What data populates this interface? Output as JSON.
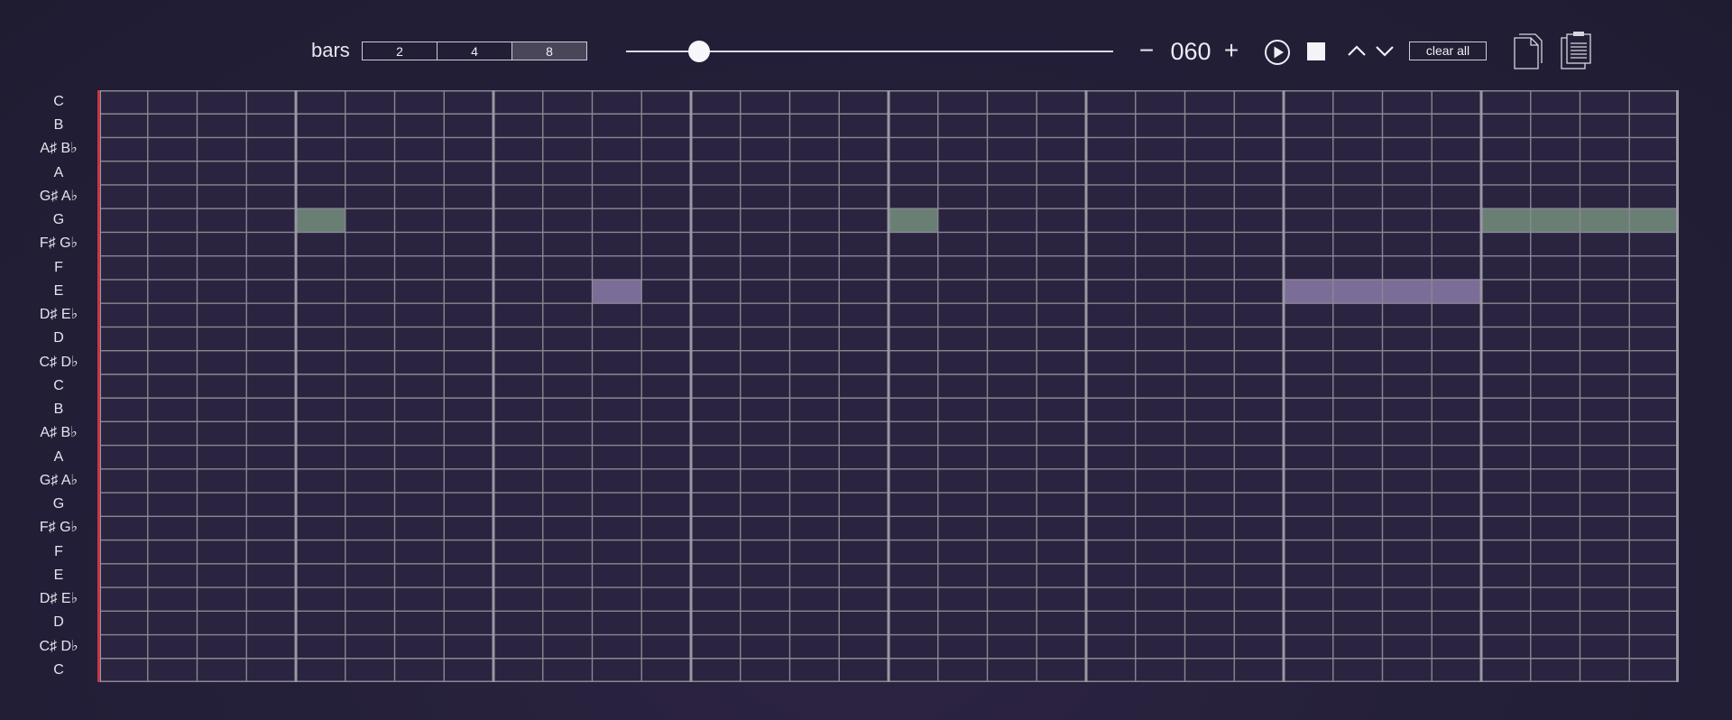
{
  "toolbar": {
    "bars_label": "bars",
    "bar_options": [
      "2",
      "4",
      "8"
    ],
    "bars_selected": "8",
    "tempo_position": 0.15,
    "tempo_minus": "−",
    "tempo_value": "060",
    "tempo_plus": "+",
    "play_icon": "play-icon",
    "stop_icon": "stop-icon",
    "octave_up_icon": "chevron-up-icon",
    "octave_down_icon": "chevron-down-icon",
    "clear_all": "clear all",
    "copy_icon": "copy-icon",
    "paste_icon": "paste-icon"
  },
  "rows": [
    "C",
    "B",
    "A♯ B♭",
    "A",
    "G♯ A♭",
    "G",
    "F♯ G♭",
    "F",
    "E",
    "D♯ E♭",
    "D",
    "C♯ D♭",
    "C",
    "B",
    "A♯ B♭",
    "A",
    "G♯ A♭",
    "G",
    "F♯ G♭",
    "F",
    "E",
    "D♯ E♭",
    "D",
    "C♯ D♭",
    "C"
  ],
  "steps": 32,
  "steps_per_bar": 4,
  "notes": [
    {
      "row": 5,
      "start": 4,
      "length": 1,
      "color": "#6a7f74"
    },
    {
      "row": 8,
      "start": 10,
      "length": 1,
      "color": "#7c6d98"
    },
    {
      "row": 5,
      "start": 16,
      "length": 1,
      "color": "#6a7f74"
    },
    {
      "row": 8,
      "start": 24,
      "length": 4,
      "color": "#7c6d98"
    },
    {
      "row": 5,
      "start": 28,
      "length": 4,
      "color": "#6a7f74"
    }
  ],
  "colors": {
    "background": "#231f36",
    "cell": "#2b2440",
    "grid_line": "#8a8893",
    "bar_line": "#9a98a2",
    "playhead": "#c23a4a"
  }
}
